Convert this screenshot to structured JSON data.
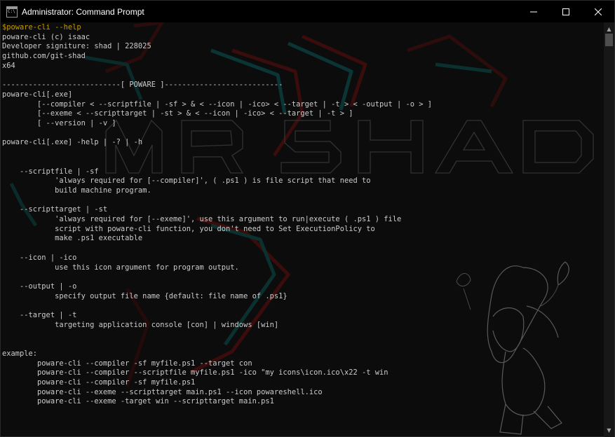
{
  "window": {
    "title": "Administrator: Command Prompt",
    "icon_label": "C:\\"
  },
  "controls": {
    "minimize": "minimize-icon",
    "maximize": "maximize-icon",
    "close": "close-icon"
  },
  "console": {
    "prompt": "$poware-cli --help",
    "output": "poware-cli (c) isaac\nDeveloper signiture: shad | 228025\ngithub.com/git-shad\nx64\n\n---------------------------[ POWARE ]---------------------------\npoware-cli[.exe]\n        [--compiler < --scriptfile | -sf > & < --icon | -ico> < --target | -t > < -output | -o > ]\n        [--exeme < --scripttarget | -st > & < --icon | -ico> < --target | -t > ]\n        [ --version | -v ]\n\npoware-cli[.exe] -help | -? | -h\n\n\n    --scriptfile | -sf\n            'always required for [--compiler]', ( .ps1 ) is file script that need to\n            build machine program.\n\n    --scripttarget | -st\n            'always required for [--exeme]', use this argument to run|execute ( .ps1 ) file\n            script with poware-cli function, you don't need to Set ExecutionPolicy to\n            make .ps1 executable\n\n    --icon | -ico\n            use this icon argument for program output.\n\n    --output | -o\n            specify output file name {default: file name of .ps1}\n\n    --target | -t\n            targeting application console [con] | windows [win]\n\n\nexample:\n        poware-cli --compiler -sf myfile.ps1 --target con\n        poware-cli --compiler --scriptfile myfile.ps1 -ico \"my icons\\icon.ico\\x22 -t win\n        poware-cli --compiler -sf myfile.ps1\n        poware-cli --exeme --scripttarget main.ps1 --icon powareshell.ico\n        poware-cli --exeme -target win --scripttarget main.ps1"
  },
  "wallpaper": {
    "text": "MR SHAD",
    "colors": {
      "red": "#7a1616",
      "cyan": "#127a7a",
      "outline": "#3a3a3a"
    }
  },
  "scrollbar": {
    "up": "▲",
    "down": "▼"
  }
}
